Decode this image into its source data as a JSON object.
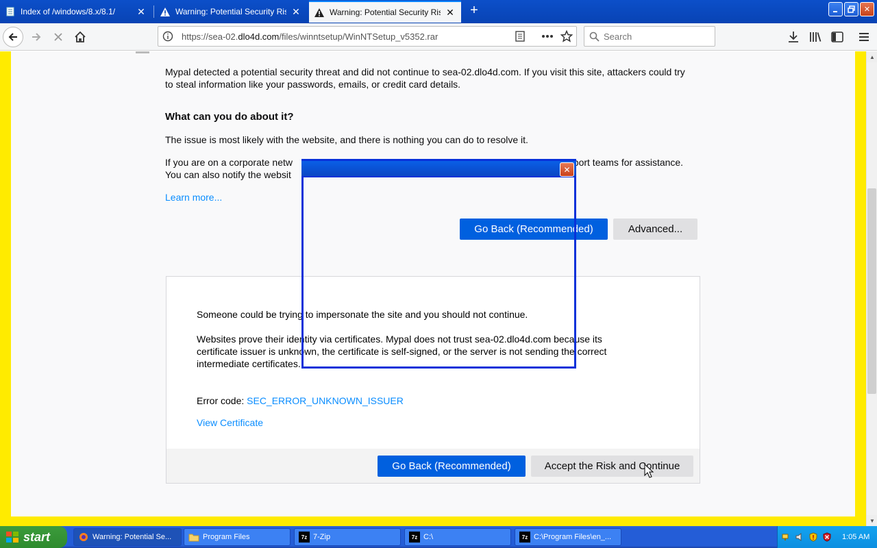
{
  "tabs": [
    {
      "title": "Index of /windows/8.x/8.1/",
      "icon": "page-icon"
    },
    {
      "title": "Warning: Potential Security Risk A",
      "icon": "warning-icon"
    },
    {
      "title": "Warning: Potential Security Risk A",
      "icon": "warning-icon",
      "active": true
    }
  ],
  "navbar": {
    "url_prefix": "https://sea-02.",
    "url_domain": "dlo4d.com",
    "url_path": "/files/winntsetup/WinNTSetup_v5352.rar",
    "search_placeholder": "Search"
  },
  "page": {
    "intro": "Mypal detected a potential security threat and did not continue to sea-02.dlo4d.com. If you visit this site, attackers could try to steal information like your passwords, emails, or credit card details.",
    "what_heading": "What can you do about it?",
    "issue_text": "The issue is most likely with the website, and there is nothing you can do to resolve it.",
    "corporate_line1": "If you are on a corporate netw",
    "corporate_line1_end": "pport teams for assistance.",
    "corporate_line2": "You can also notify the websit",
    "learn_more": "Learn more...",
    "go_back_button": "Go Back (Recommended)",
    "advanced_button": "Advanced..."
  },
  "advanced": {
    "impersonate": "Someone could be trying to impersonate the site and you should not continue.",
    "certs_text": "Websites prove their identity via certificates. Mypal does not trust sea-02.dlo4d.com because its certificate issuer is unknown, the certificate is self-signed, or the server is not sending the correct intermediate certificates.",
    "error_label": "Error code: ",
    "error_code": "SEC_ERROR_UNKNOWN_ISSUER",
    "view_certificate": "View Certificate",
    "go_back_button": "Go Back (Recommended)",
    "accept_button": "Accept the Risk and Continue"
  },
  "taskbar": {
    "start_label": "start",
    "items": [
      {
        "label": "Warning: Potential Se...",
        "icon": "firefox-icon"
      },
      {
        "label": "Program Files",
        "icon": "folder-icon"
      },
      {
        "label": "7-Zip",
        "icon": "7zip-icon"
      },
      {
        "label": "C:\\",
        "icon": "7zip-icon"
      },
      {
        "label": "C:\\Program Files\\en_...",
        "icon": "7zip-icon"
      }
    ],
    "clock": "1:05 AM"
  },
  "colors": {
    "accent": "#0060df",
    "link": "#0a8dff",
    "frame_yellow": "#ffeb00",
    "xp_blue": "#245dd7"
  }
}
